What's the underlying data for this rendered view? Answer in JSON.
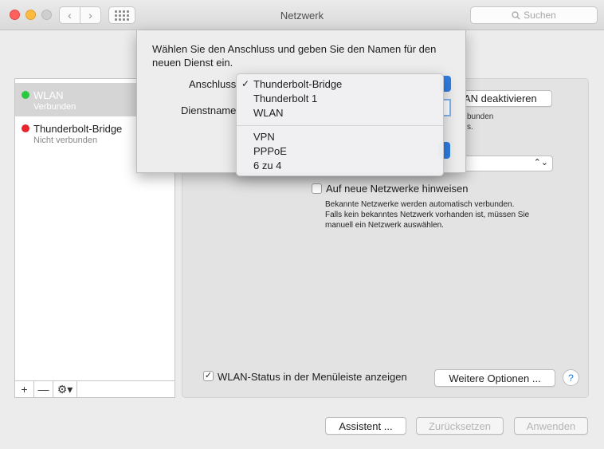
{
  "window": {
    "title": "Netzwerk",
    "search_placeholder": "Suchen"
  },
  "sidebar": {
    "services": [
      {
        "name": "WLAN",
        "status": "Verbunden",
        "status_color": "#2ac940"
      },
      {
        "name": "Thunderbolt-Bridge",
        "status": "Nicht verbunden",
        "status_color": "#e8242e"
      }
    ],
    "tools": {
      "add": "+",
      "remove": "—",
      "gear": "⚙▾"
    }
  },
  "main": {
    "wlan_toggle_label": "AN deaktivieren",
    "status_fragment_1": "bunden",
    "status_fragment_2": "s.",
    "ask_new_networks_label": "Auf neue Netzwerke hinweisen",
    "ask_new_networks_checked": false,
    "note_lines": [
      "Bekannte Netzwerke werden automatisch verbunden.",
      "Falls kein bekanntes Netzwerk vorhanden ist, müssen Sie",
      "manuell ein Netzwerk auswählen."
    ],
    "menubar_status_label": "WLAN-Status in der Menüleiste anzeigen",
    "menubar_status_checked": true,
    "more_options_label": "Weitere Optionen ...",
    "help_label": "?"
  },
  "footer": {
    "assistant_label": "Assistent ...",
    "reset_label": "Zurücksetzen",
    "apply_label": "Anwenden"
  },
  "sheet": {
    "message": "Wählen Sie den Anschluss und geben Sie den Namen für den neuen Dienst ein.",
    "interface_label": "Anschluss",
    "service_name_label": "Dienstname"
  },
  "interface_menu": {
    "selected": "Thunderbolt-Bridge",
    "check_mark": "✓",
    "group1": [
      "Thunderbolt-Bridge",
      "Thunderbolt 1",
      "WLAN"
    ],
    "group2": [
      "VPN",
      "PPPoE",
      "6 zu 4"
    ]
  },
  "colors": {
    "accent": "#2e7de3",
    "help": "#1f7ae0"
  }
}
